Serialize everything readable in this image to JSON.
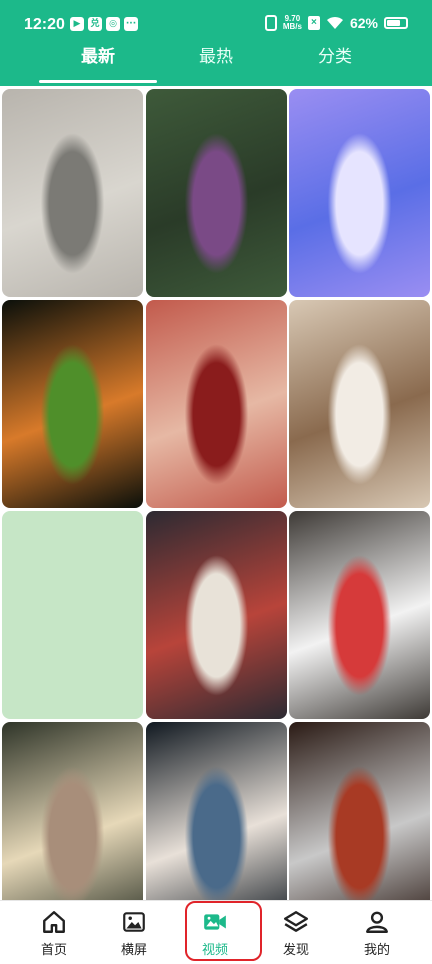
{
  "status": {
    "time": "12:20",
    "app_icons": [
      "▶",
      "兑",
      "◎",
      "···"
    ],
    "speed_value": "9.70",
    "speed_unit": "MB/s",
    "battery": "62%"
  },
  "tabs": [
    {
      "label": "最新",
      "active": true
    },
    {
      "label": "最热",
      "active": false
    },
    {
      "label": "分类",
      "active": false
    }
  ],
  "nav": [
    {
      "label": "首页",
      "icon": "home-icon",
      "active": false
    },
    {
      "label": "横屏",
      "icon": "image-icon",
      "active": false
    },
    {
      "label": "视频",
      "icon": "video-icon",
      "active": true
    },
    {
      "label": "发现",
      "icon": "layers-icon",
      "active": false
    },
    {
      "label": "我的",
      "icon": "person-icon",
      "active": false
    }
  ],
  "colors": {
    "brand": "#1cb98a",
    "highlight": "#e0242a"
  },
  "thumbnails": [
    {
      "kind": "photo-woman-street",
      "palette": [
        "#b8b4ad",
        "#7b7a75",
        "#d9d6cf"
      ]
    },
    {
      "kind": "photo-woman-purple-dress",
      "palette": [
        "#3e5a3a",
        "#7a4a86",
        "#2a3b28"
      ]
    },
    {
      "kind": "illustration-white-bunny",
      "palette": [
        "#9a8ef2",
        "#e6e4ff",
        "#5a6ee6"
      ]
    },
    {
      "kind": "photo-aquarium-fish",
      "palette": [
        "#0a0f0a",
        "#4f8f2a",
        "#d87a2a"
      ]
    },
    {
      "kind": "photo-woman-red-flowers",
      "palette": [
        "#c25a4c",
        "#8a1c1c",
        "#e6b8a4"
      ]
    },
    {
      "kind": "photo-woman-white-outfit",
      "palette": [
        "#d8c8b4",
        "#f2ece4",
        "#8a6a4e"
      ]
    },
    {
      "kind": "blank-pale-green",
      "palette": [
        "#c6e6c6",
        "#c6e6c6",
        "#c6e6c6"
      ]
    },
    {
      "kind": "photo-woman-white-dress-night",
      "palette": [
        "#2c2a32",
        "#e8e2d8",
        "#b8443a"
      ]
    },
    {
      "kind": "photo-woman-red-top",
      "palette": [
        "#3e3a36",
        "#d63a3a",
        "#f2f2f2"
      ]
    },
    {
      "kind": "photo-woman-beige-dress-lights",
      "palette": [
        "#2e3428",
        "#a88e7a",
        "#e6d8b8"
      ]
    },
    {
      "kind": "photo-woman-night-street",
      "palette": [
        "#101820",
        "#4a6a8a",
        "#e8e0d8"
      ]
    },
    {
      "kind": "photo-woman-train-door",
      "palette": [
        "#2a1a14",
        "#a83a24",
        "#c8c8c8"
      ]
    }
  ]
}
